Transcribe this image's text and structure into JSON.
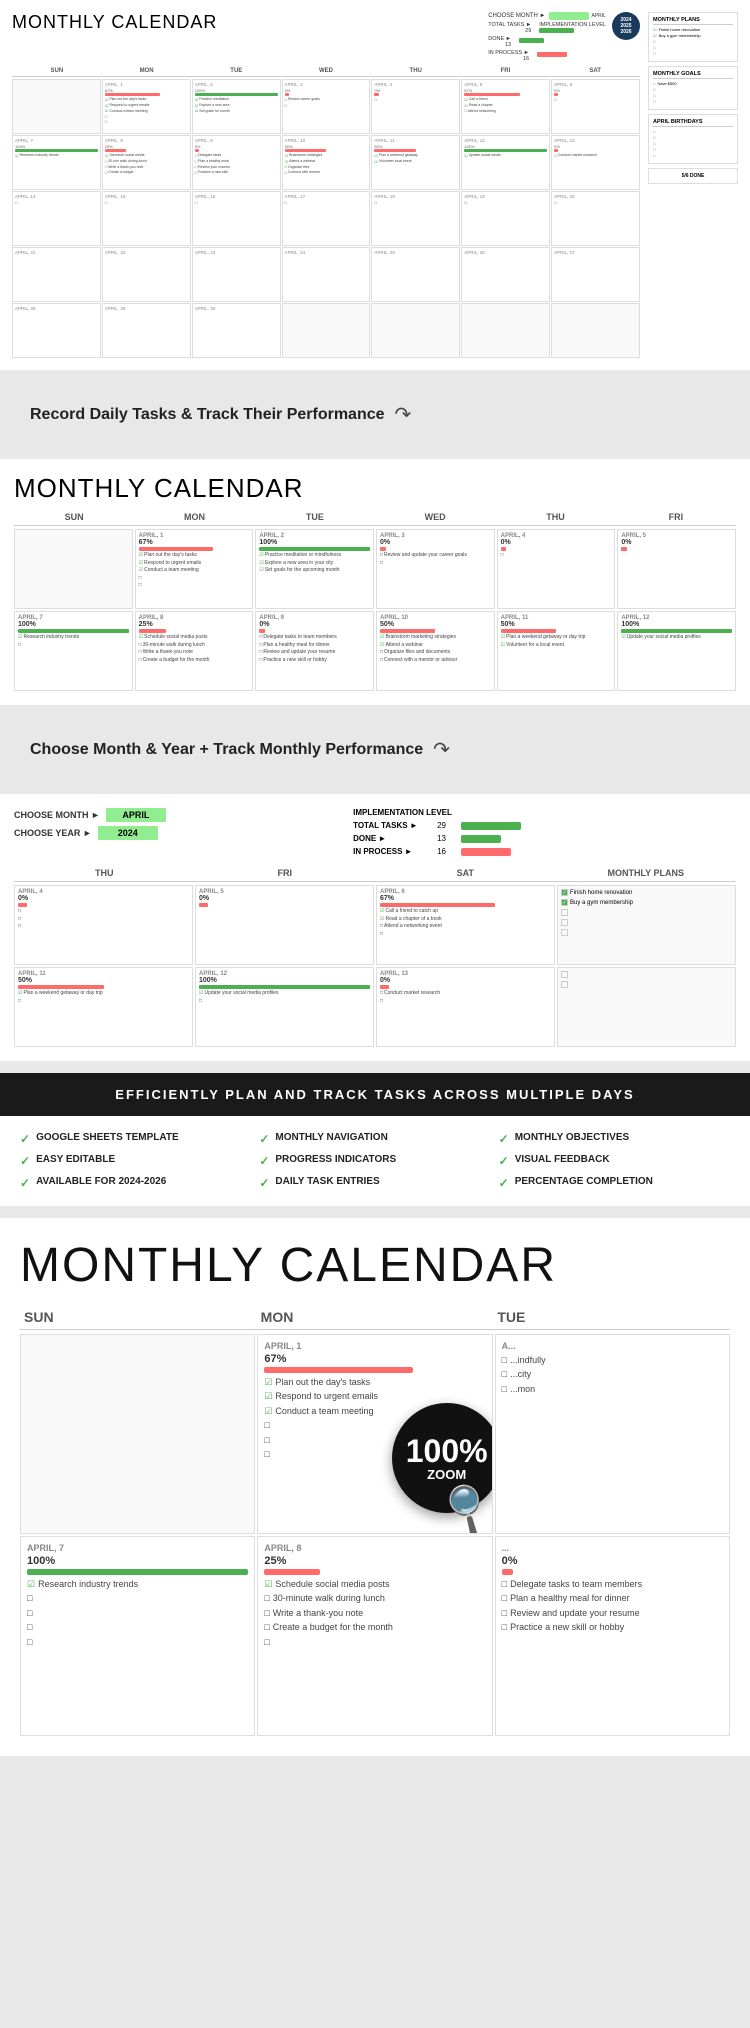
{
  "section1": {
    "title": "MONTHLY",
    "title_light": " CALENDAR",
    "choose_month_label": "CHOOSE MONTH ►",
    "choose_month_value": "APRIL",
    "total_tasks_label": "TOTAL TASKS ►",
    "total_tasks_value": "29",
    "implementation_label": "IMPLEMENTATION LEVEL",
    "done_label": "DONE ►",
    "done_value": "13",
    "in_process_label": "IN PROCESS ►",
    "in_process_value": "16",
    "badge_years": [
      "2024",
      "2025",
      "2026"
    ],
    "days": [
      "SUN",
      "MON",
      "TUE",
      "WED",
      "THU",
      "FRI",
      "SAT"
    ],
    "monthly_plans_title": "MONTHLY PLANS",
    "monthly_plans": [
      {
        "text": "Finish home renovation",
        "checked": true
      },
      {
        "text": "Buy a gym membership",
        "checked": true
      },
      {
        "text": "",
        "checked": false
      },
      {
        "text": "",
        "checked": false
      },
      {
        "text": "",
        "checked": false
      }
    ],
    "monthly_goals_title": "MONTHLY GOALS",
    "monthly_goals": [
      {
        "text": "Save $500",
        "checked": false
      },
      {
        "text": "",
        "checked": false
      },
      {
        "text": "",
        "checked": false
      },
      {
        "text": "",
        "checked": false
      }
    ],
    "april_birthdays_title": "APRIL BIRTHDAYS",
    "birthdays": [
      {
        "text": "",
        "checked": false
      },
      {
        "text": "",
        "checked": false
      },
      {
        "text": "",
        "checked": false
      },
      {
        "text": "",
        "checked": false
      },
      {
        "text": "",
        "checked": false
      }
    ],
    "done_stat": "5/6 DONE"
  },
  "transition1": {
    "text": "Record Daily Tasks & Track Their Performance"
  },
  "section2": {
    "title": "MONTHLY",
    "title_light": " CALENDAR",
    "days": [
      "SUN",
      "MON",
      "TUE",
      "WED",
      "THU",
      "FRI"
    ],
    "cells": [
      {
        "date": "",
        "pct": "",
        "tasks": [],
        "empty": true
      },
      {
        "date": "APRIL, 1",
        "pct": "67%",
        "pct_color": "red",
        "tasks": [
          {
            "text": "Plan out the day's tasks",
            "checked": true
          },
          {
            "text": "Respond to urgent emails",
            "checked": true
          },
          {
            "text": "Conduct a team meeting",
            "checked": true
          },
          {
            "text": "",
            "checked": false
          },
          {
            "text": "",
            "checked": false
          }
        ]
      },
      {
        "date": "APRIL, 2",
        "pct": "100%",
        "pct_color": "green",
        "tasks": [
          {
            "text": "Practice meditation or mindfulness",
            "checked": true
          },
          {
            "text": "Explore a new area in your city",
            "checked": true
          },
          {
            "text": "Set goals for the upcoming month",
            "checked": true
          },
          {
            "text": "",
            "checked": false
          }
        ]
      },
      {
        "date": "APRIL, 3",
        "pct": "0%",
        "pct_color": "red",
        "tasks": [
          {
            "text": "Review and update your career goals",
            "checked": false
          },
          {
            "text": "",
            "checked": false
          },
          {
            "text": "",
            "checked": false
          }
        ]
      },
      {
        "date": "APRIL, 4",
        "pct": "0%",
        "pct_color": "red",
        "tasks": [
          {
            "text": "",
            "checked": false
          },
          {
            "text": "",
            "checked": false
          }
        ]
      },
      {
        "date": "APRIL, 5",
        "pct": "0%",
        "pct_color": "red",
        "tasks": [
          {
            "text": "",
            "checked": false
          }
        ]
      },
      {
        "date": "APRIL, 7",
        "pct": "100%",
        "pct_color": "green",
        "tasks": [
          {
            "text": "Research industry trends",
            "checked": true
          },
          {
            "text": "",
            "checked": false
          },
          {
            "text": "",
            "checked": false
          }
        ]
      },
      {
        "date": "APRIL, 8",
        "pct": "25%",
        "pct_color": "red",
        "tasks": [
          {
            "text": "Schedule social media posts",
            "checked": true
          },
          {
            "text": "30-minute walk during lunch",
            "checked": false
          },
          {
            "text": "Write a thank-you note",
            "checked": false
          },
          {
            "text": "Create a budget for the month",
            "checked": false
          }
        ]
      },
      {
        "date": "APRIL, 9",
        "pct": "0%",
        "pct_color": "red",
        "tasks": [
          {
            "text": "Delegate tasks to team members",
            "checked": false
          },
          {
            "text": "Practice a healthy meal for dinner",
            "checked": false
          },
          {
            "text": "Review and update your resume",
            "checked": false
          },
          {
            "text": "Practice a new skill or hobby",
            "checked": false
          }
        ]
      },
      {
        "date": "APRIL, 10",
        "pct": "50%",
        "pct_color": "red",
        "tasks": [
          {
            "text": "Brainstorm marketing strategies",
            "checked": true
          },
          {
            "text": "Attend a webinar",
            "checked": true
          },
          {
            "text": "Organize files and documents",
            "checked": false
          },
          {
            "text": "Connect with a mentor or advisor",
            "checked": false
          }
        ]
      },
      {
        "date": "APRIL, 11",
        "pct": "50%",
        "pct_color": "red",
        "tasks": [
          {
            "text": "Plan a weekend getaway or day trip",
            "checked": true
          },
          {
            "text": "Volunteer for a local event",
            "checked": true
          },
          {
            "text": "",
            "checked": false
          }
        ]
      },
      {
        "date": "APRIL, 12",
        "pct": "100%",
        "pct_color": "green",
        "tasks": [
          {
            "text": "Update your social media profiles",
            "checked": true
          },
          {
            "text": "",
            "checked": false
          }
        ]
      }
    ]
  },
  "transition2": {
    "text": "Choose Month & Year + Track Monthly Performance"
  },
  "section3": {
    "choose_month_label": "CHOOSE MONTH ►",
    "choose_month_value": "APRIL",
    "choose_year_label": "CHOOSE YEAR ►",
    "choose_year_value": "2024",
    "total_tasks_label": "TOTAL TASKS ►",
    "total_tasks_value": "29",
    "impl_level_label": "IMPLEMENTATION LEVEL",
    "done_label": "DONE ►",
    "done_value": "13",
    "in_process_label": "IN PROCESS ►",
    "in_process_value": "16",
    "days": [
      "THU",
      "FRI",
      "SAT",
      "MONTHLY PLANS"
    ],
    "cells": [
      {
        "date": "APRIL, 4",
        "pct": "0%",
        "pct_color": "red",
        "tasks": [
          {
            "text": "",
            "checked": false
          },
          {
            "text": "",
            "checked": false
          },
          {
            "text": "",
            "checked": false
          }
        ]
      },
      {
        "date": "APRIL, 5",
        "pct": "0%",
        "pct_color": "red",
        "tasks": [
          {
            "text": "",
            "checked": false
          }
        ]
      },
      {
        "date": "APRIL, 6",
        "pct": "67%",
        "pct_color": "red",
        "tasks": [
          {
            "text": "Call a friend to catch up",
            "checked": true
          },
          {
            "text": "Read a chapter of a book",
            "checked": true
          },
          {
            "text": "Attend a networking event",
            "checked": false
          },
          {
            "text": "",
            "checked": false
          }
        ]
      },
      {
        "date": "APRIL, 11",
        "pct": "50%",
        "pct_color": "red",
        "tasks": [
          {
            "text": "Plan a weekend getaway or day trip",
            "checked": true
          },
          {
            "text": "",
            "checked": false
          }
        ]
      },
      {
        "date": "APRIL, 12",
        "pct": "100%",
        "pct_color": "green",
        "tasks": [
          {
            "text": "Update your social media profiles",
            "checked": true
          },
          {
            "text": "",
            "checked": false
          }
        ]
      },
      {
        "date": "APRIL, 13",
        "pct": "0%",
        "pct_color": "red",
        "tasks": [
          {
            "text": "Conduct market research",
            "checked": false
          },
          {
            "text": "",
            "checked": false
          }
        ]
      }
    ],
    "plans": [
      {
        "text": "Finish home renovation",
        "checked": true
      },
      {
        "text": "Buy a gym membership",
        "checked": true
      },
      {
        "text": "",
        "checked": false
      },
      {
        "text": "",
        "checked": false
      },
      {
        "text": "",
        "checked": false
      },
      {
        "text": "",
        "checked": false
      },
      {
        "text": "",
        "checked": false
      }
    ]
  },
  "dark_banner": {
    "text": "EFFICIENTLY PLAN AND TRACK TASKS ACROSS MULTIPLE DAYS"
  },
  "features": {
    "items": [
      {
        "icon": "✓",
        "text": "GOOGLE SHEETS TEMPLATE"
      },
      {
        "icon": "✓",
        "text": "MONTHLY NAVIGATION"
      },
      {
        "icon": "✓",
        "text": "MONTHLY OBJECTIVES"
      },
      {
        "icon": "✓",
        "text": "EASY EDITABLE"
      },
      {
        "icon": "✓",
        "text": "PROGRESS INDICATORS"
      },
      {
        "icon": "✓",
        "text": "VISUAL FEEDBACK"
      },
      {
        "icon": "✓",
        "text": "AVAILABLE FOR 2024-2026"
      },
      {
        "icon": "✓",
        "text": "DAILY TASK ENTRIES"
      },
      {
        "icon": "✓",
        "text": "PERCENTAGE COMPLETION"
      }
    ]
  },
  "section4": {
    "title": "MONTHLY",
    "title_light": " CALENDAR",
    "days": [
      "SUN",
      "MON",
      "TUE"
    ],
    "zoom_pct": "100%",
    "zoom_label": "ZOOM",
    "cells": [
      {
        "date": "",
        "empty": true
      },
      {
        "date": "APRIL, 1",
        "pct": "67%",
        "pct_color": "red",
        "tasks": [
          {
            "text": "Plan out the day's tasks",
            "checked": true
          },
          {
            "text": "Respond to urgent emails",
            "checked": true
          },
          {
            "text": "Conduct a team meeting",
            "checked": true
          },
          {
            "text": "",
            "checked": false
          },
          {
            "text": "",
            "checked": false
          },
          {
            "text": "",
            "checked": false
          }
        ]
      },
      {
        "date": "A...",
        "pct": "",
        "pct_color": "green",
        "tasks": [
          {
            "text": "...indfully",
            "checked": false
          },
          {
            "text": "...city",
            "checked": false
          },
          {
            "text": "...mon",
            "checked": false
          }
        ]
      },
      {
        "date": "APRIL, 7",
        "pct": "100%",
        "pct_color": "green",
        "tasks": [
          {
            "text": "Research industry trends",
            "checked": true
          },
          {
            "text": "",
            "checked": false
          },
          {
            "text": "",
            "checked": false
          },
          {
            "text": "",
            "checked": false
          },
          {
            "text": "",
            "checked": false
          }
        ]
      },
      {
        "date": "APRIL, 8",
        "pct": "25%",
        "pct_color": "red",
        "tasks": [
          {
            "text": "Schedule social media posts",
            "checked": true
          },
          {
            "text": "30-minute walk during lunch",
            "checked": false
          },
          {
            "text": "Write a thank-you note",
            "checked": false
          },
          {
            "text": "Create a budget for the month",
            "checked": false
          },
          {
            "text": "",
            "checked": false
          }
        ]
      },
      {
        "date": "...",
        "pct": "0%",
        "pct_color": "red",
        "tasks": [
          {
            "text": "Delegate tasks to team members",
            "checked": false
          },
          {
            "text": "Plan a healthy meal for dinner",
            "checked": false
          },
          {
            "text": "Review and update your resume",
            "checked": false
          },
          {
            "text": "Practice a new skill or hobby",
            "checked": false
          }
        ]
      }
    ]
  }
}
